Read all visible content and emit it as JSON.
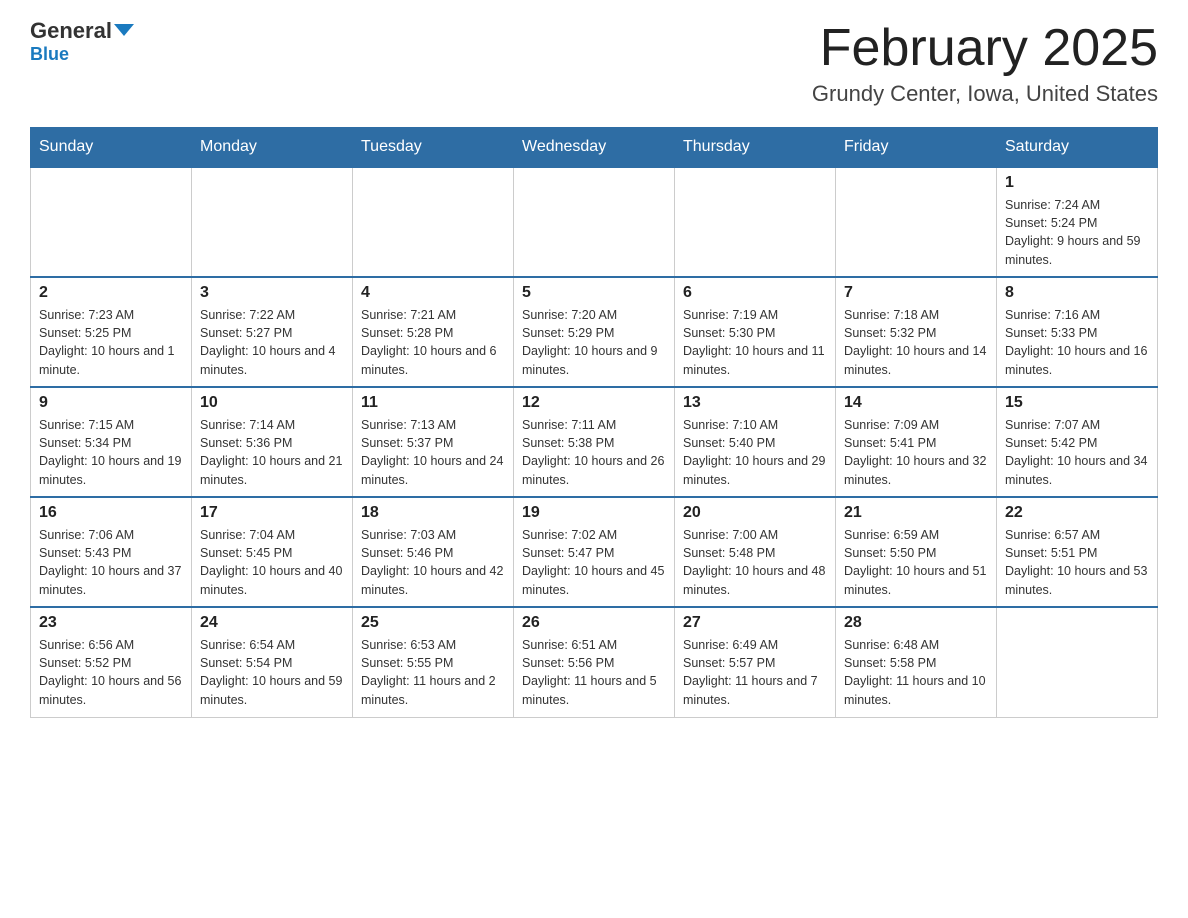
{
  "header": {
    "logo_general": "General",
    "logo_blue": "Blue",
    "month_title": "February 2025",
    "location": "Grundy Center, Iowa, United States"
  },
  "weekdays": [
    "Sunday",
    "Monday",
    "Tuesday",
    "Wednesday",
    "Thursday",
    "Friday",
    "Saturday"
  ],
  "weeks": [
    [
      {
        "day": "",
        "sunrise": "",
        "sunset": "",
        "daylight": ""
      },
      {
        "day": "",
        "sunrise": "",
        "sunset": "",
        "daylight": ""
      },
      {
        "day": "",
        "sunrise": "",
        "sunset": "",
        "daylight": ""
      },
      {
        "day": "",
        "sunrise": "",
        "sunset": "",
        "daylight": ""
      },
      {
        "day": "",
        "sunrise": "",
        "sunset": "",
        "daylight": ""
      },
      {
        "day": "",
        "sunrise": "",
        "sunset": "",
        "daylight": ""
      },
      {
        "day": "1",
        "sunrise": "Sunrise: 7:24 AM",
        "sunset": "Sunset: 5:24 PM",
        "daylight": "Daylight: 9 hours and 59 minutes."
      }
    ],
    [
      {
        "day": "2",
        "sunrise": "Sunrise: 7:23 AM",
        "sunset": "Sunset: 5:25 PM",
        "daylight": "Daylight: 10 hours and 1 minute."
      },
      {
        "day": "3",
        "sunrise": "Sunrise: 7:22 AM",
        "sunset": "Sunset: 5:27 PM",
        "daylight": "Daylight: 10 hours and 4 minutes."
      },
      {
        "day": "4",
        "sunrise": "Sunrise: 7:21 AM",
        "sunset": "Sunset: 5:28 PM",
        "daylight": "Daylight: 10 hours and 6 minutes."
      },
      {
        "day": "5",
        "sunrise": "Sunrise: 7:20 AM",
        "sunset": "Sunset: 5:29 PM",
        "daylight": "Daylight: 10 hours and 9 minutes."
      },
      {
        "day": "6",
        "sunrise": "Sunrise: 7:19 AM",
        "sunset": "Sunset: 5:30 PM",
        "daylight": "Daylight: 10 hours and 11 minutes."
      },
      {
        "day": "7",
        "sunrise": "Sunrise: 7:18 AM",
        "sunset": "Sunset: 5:32 PM",
        "daylight": "Daylight: 10 hours and 14 minutes."
      },
      {
        "day": "8",
        "sunrise": "Sunrise: 7:16 AM",
        "sunset": "Sunset: 5:33 PM",
        "daylight": "Daylight: 10 hours and 16 minutes."
      }
    ],
    [
      {
        "day": "9",
        "sunrise": "Sunrise: 7:15 AM",
        "sunset": "Sunset: 5:34 PM",
        "daylight": "Daylight: 10 hours and 19 minutes."
      },
      {
        "day": "10",
        "sunrise": "Sunrise: 7:14 AM",
        "sunset": "Sunset: 5:36 PM",
        "daylight": "Daylight: 10 hours and 21 minutes."
      },
      {
        "day": "11",
        "sunrise": "Sunrise: 7:13 AM",
        "sunset": "Sunset: 5:37 PM",
        "daylight": "Daylight: 10 hours and 24 minutes."
      },
      {
        "day": "12",
        "sunrise": "Sunrise: 7:11 AM",
        "sunset": "Sunset: 5:38 PM",
        "daylight": "Daylight: 10 hours and 26 minutes."
      },
      {
        "day": "13",
        "sunrise": "Sunrise: 7:10 AM",
        "sunset": "Sunset: 5:40 PM",
        "daylight": "Daylight: 10 hours and 29 minutes."
      },
      {
        "day": "14",
        "sunrise": "Sunrise: 7:09 AM",
        "sunset": "Sunset: 5:41 PM",
        "daylight": "Daylight: 10 hours and 32 minutes."
      },
      {
        "day": "15",
        "sunrise": "Sunrise: 7:07 AM",
        "sunset": "Sunset: 5:42 PM",
        "daylight": "Daylight: 10 hours and 34 minutes."
      }
    ],
    [
      {
        "day": "16",
        "sunrise": "Sunrise: 7:06 AM",
        "sunset": "Sunset: 5:43 PM",
        "daylight": "Daylight: 10 hours and 37 minutes."
      },
      {
        "day": "17",
        "sunrise": "Sunrise: 7:04 AM",
        "sunset": "Sunset: 5:45 PM",
        "daylight": "Daylight: 10 hours and 40 minutes."
      },
      {
        "day": "18",
        "sunrise": "Sunrise: 7:03 AM",
        "sunset": "Sunset: 5:46 PM",
        "daylight": "Daylight: 10 hours and 42 minutes."
      },
      {
        "day": "19",
        "sunrise": "Sunrise: 7:02 AM",
        "sunset": "Sunset: 5:47 PM",
        "daylight": "Daylight: 10 hours and 45 minutes."
      },
      {
        "day": "20",
        "sunrise": "Sunrise: 7:00 AM",
        "sunset": "Sunset: 5:48 PM",
        "daylight": "Daylight: 10 hours and 48 minutes."
      },
      {
        "day": "21",
        "sunrise": "Sunrise: 6:59 AM",
        "sunset": "Sunset: 5:50 PM",
        "daylight": "Daylight: 10 hours and 51 minutes."
      },
      {
        "day": "22",
        "sunrise": "Sunrise: 6:57 AM",
        "sunset": "Sunset: 5:51 PM",
        "daylight": "Daylight: 10 hours and 53 minutes."
      }
    ],
    [
      {
        "day": "23",
        "sunrise": "Sunrise: 6:56 AM",
        "sunset": "Sunset: 5:52 PM",
        "daylight": "Daylight: 10 hours and 56 minutes."
      },
      {
        "day": "24",
        "sunrise": "Sunrise: 6:54 AM",
        "sunset": "Sunset: 5:54 PM",
        "daylight": "Daylight: 10 hours and 59 minutes."
      },
      {
        "day": "25",
        "sunrise": "Sunrise: 6:53 AM",
        "sunset": "Sunset: 5:55 PM",
        "daylight": "Daylight: 11 hours and 2 minutes."
      },
      {
        "day": "26",
        "sunrise": "Sunrise: 6:51 AM",
        "sunset": "Sunset: 5:56 PM",
        "daylight": "Daylight: 11 hours and 5 minutes."
      },
      {
        "day": "27",
        "sunrise": "Sunrise: 6:49 AM",
        "sunset": "Sunset: 5:57 PM",
        "daylight": "Daylight: 11 hours and 7 minutes."
      },
      {
        "day": "28",
        "sunrise": "Sunrise: 6:48 AM",
        "sunset": "Sunset: 5:58 PM",
        "daylight": "Daylight: 11 hours and 10 minutes."
      },
      {
        "day": "",
        "sunrise": "",
        "sunset": "",
        "daylight": ""
      }
    ]
  ]
}
